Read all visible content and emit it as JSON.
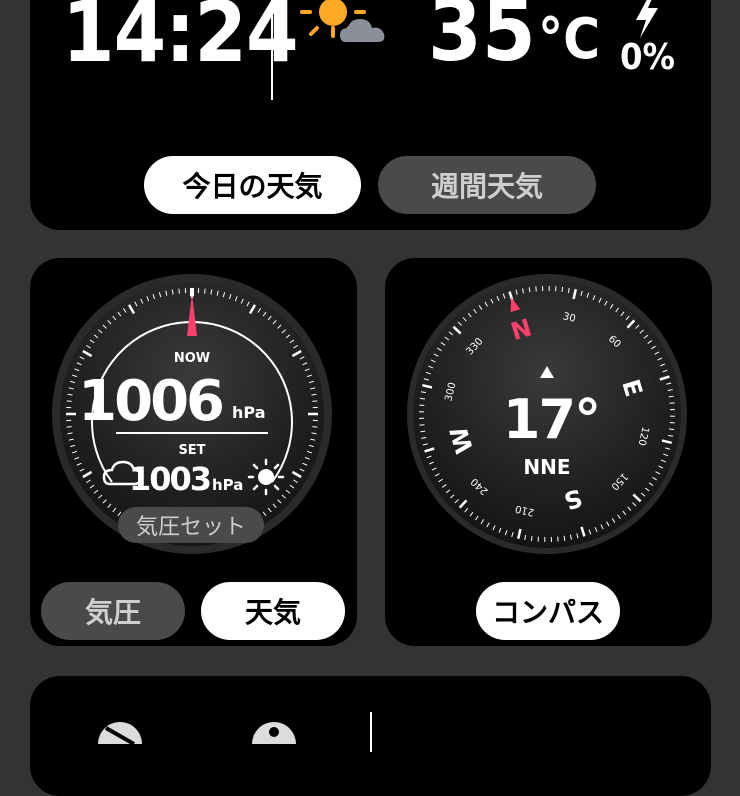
{
  "status": {
    "time": "14:24",
    "temperature": "35",
    "temperature_unit": "°C",
    "precipitation": "0%"
  },
  "weather_tabs": [
    {
      "label": "今日の天気",
      "selected": true
    },
    {
      "label": "週間天気",
      "selected": false
    }
  ],
  "barometer": {
    "now_label": "NOW",
    "now_value": "1006",
    "unit": "hPa",
    "set_label": "SET",
    "set_value": "1003",
    "set_button": "気圧セット",
    "tabs": [
      {
        "label": "気圧",
        "selected": false
      },
      {
        "label": "天気",
        "selected": true
      }
    ]
  },
  "compass": {
    "heading": "17°",
    "direction": "NNE",
    "cardinals": {
      "north": "N",
      "east": "E",
      "south": "S",
      "west": "W"
    },
    "ticks": [
      "30",
      "60",
      "120",
      "150",
      "210",
      "240",
      "300",
      "330"
    ],
    "button": "コンパス"
  },
  "colors": {
    "accent_needle": "#ff3f6c",
    "card_bg": "#000000",
    "page_bg": "#333333",
    "pill_off": "#4a4a4a"
  },
  "icons": [
    "sun-icon",
    "cloud-icon",
    "lightning-icon",
    "sunny-icon",
    "cloudy-icon",
    "triangle-up-icon",
    "tidal-icon"
  ]
}
